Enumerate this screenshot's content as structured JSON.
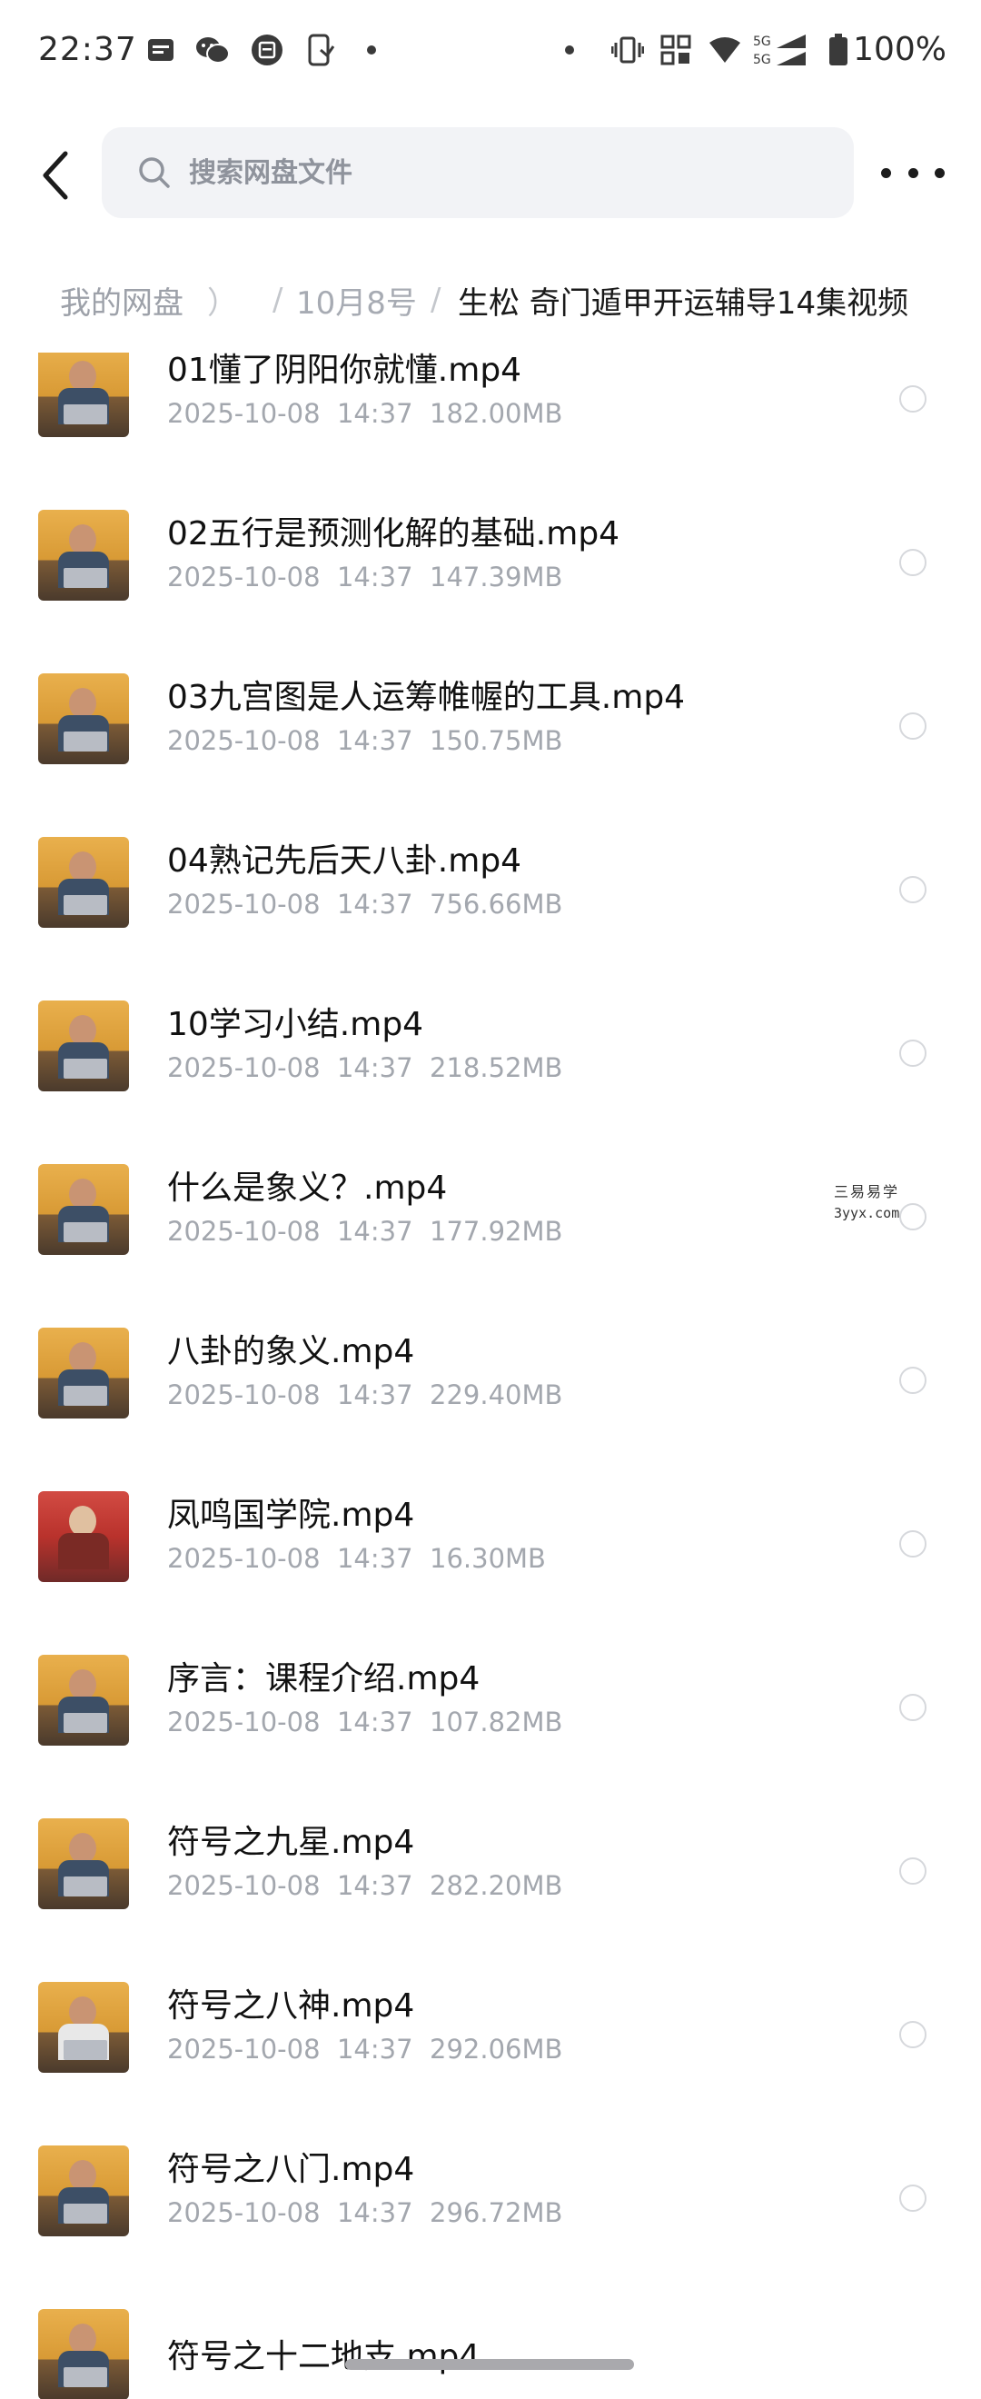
{
  "status_bar": {
    "time": "22:37",
    "battery": "100%",
    "left_icons": [
      "message-icon",
      "wechat-icon",
      "calendar-icon",
      "phone-link-icon",
      "dot-icon"
    ],
    "right_icons": [
      "dot-icon",
      "vibrate-icon",
      "nfc-icon",
      "wifi-icon",
      "signal-5g-icon",
      "battery-icon"
    ],
    "network_label": "5G"
  },
  "top_bar": {
    "back_icon": "chevron-left-icon",
    "search_placeholder": "搜索网盘文件",
    "more_icon": "more-icon"
  },
  "breadcrumb": {
    "root": "我的网盘",
    "hidden_fragment": "）",
    "separator": "/",
    "folder": "10月8号",
    "current": "生松 奇门遁甲开运辅导14集视频"
  },
  "files": [
    {
      "name": "01懂了阴阳你就懂.mp4",
      "date": "2025-10-08",
      "time": "14:37",
      "size": "182.00MB"
    },
    {
      "name": "02五行是预测化解的基础.mp4",
      "date": "2025-10-08",
      "time": "14:37",
      "size": "147.39MB"
    },
    {
      "name": "03九宫图是人运筹帷幄的工具.mp4",
      "date": "2025-10-08",
      "time": "14:37",
      "size": "150.75MB"
    },
    {
      "name": "04熟记先后天八卦.mp4",
      "date": "2025-10-08",
      "time": "14:37",
      "size": "756.66MB"
    },
    {
      "name": "10学习小结.mp4",
      "date": "2025-10-08",
      "time": "14:37",
      "size": "218.52MB"
    },
    {
      "name": "什么是象义？.mp4",
      "date": "2025-10-08",
      "time": "14:37",
      "size": "177.92MB"
    },
    {
      "name": "八卦的象义.mp4",
      "date": "2025-10-08",
      "time": "14:37",
      "size": "229.40MB"
    },
    {
      "name": "凤鸣国学院.mp4",
      "date": "2025-10-08",
      "time": "14:37",
      "size": "16.30MB"
    },
    {
      "name": "序言：课程介绍.mp4",
      "date": "2025-10-08",
      "time": "14:37",
      "size": "107.82MB"
    },
    {
      "name": "符号之九星.mp4",
      "date": "2025-10-08",
      "time": "14:37",
      "size": "282.20MB"
    },
    {
      "name": "符号之八神.mp4",
      "date": "2025-10-08",
      "time": "14:37",
      "size": "292.06MB"
    },
    {
      "name": "符号之八门.mp4",
      "date": "2025-10-08",
      "time": "14:37",
      "size": "296.72MB"
    },
    {
      "name": "符号之十二地支.mp4",
      "date": "",
      "time": "",
      "size": ""
    }
  ],
  "watermark": {
    "line1": "三易易学",
    "line2": "3yyx.com"
  },
  "colors": {
    "accent_text": "#111111",
    "meta_text": "#a3a7ae",
    "search_bg": "#f2f3f6"
  }
}
